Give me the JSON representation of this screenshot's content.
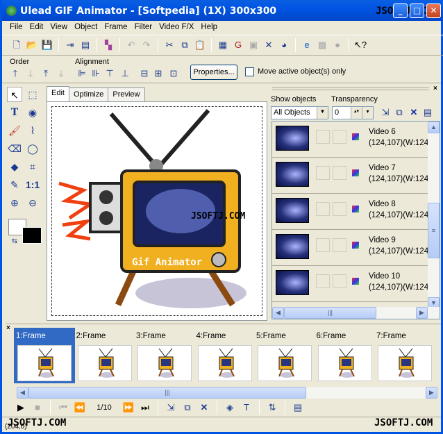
{
  "window": {
    "title": "Ulead GIF Animator - [Softpedia] (1X) 300x300",
    "watermark": "JSOFTJ.COM",
    "controls": [
      "_",
      "□",
      "✕"
    ]
  },
  "menu": [
    "File",
    "Edit",
    "View",
    "Object",
    "Frame",
    "Filter",
    "Video F/X",
    "Help"
  ],
  "toolbar": {
    "icons": [
      "new-icon",
      "open-icon",
      "save-icon",
      "import-icon",
      "export-icon",
      "optimize-icon",
      "undo-icon",
      "redo-icon",
      "cut-icon",
      "copy-icon",
      "paste-icon",
      "frame-icon",
      "gif-icon",
      "image-icon",
      "crop-icon",
      "preview-icon",
      "ie-icon",
      "disabled-icon",
      "disabled-icon2",
      "help-icon"
    ]
  },
  "order": {
    "label": "Order"
  },
  "alignment": {
    "label": "Alignment"
  },
  "properties_button": "Properties...",
  "move_active_label": "Move active object(s) only",
  "move_active_checked": false,
  "tabs": [
    "Edit",
    "Optimize",
    "Preview"
  ],
  "active_tab": "Edit",
  "canvas": {
    "tv_text": "Gif Animator",
    "watermark": "JSOFTJ.COM"
  },
  "panel": {
    "show_objects_label": "Show objects",
    "show_objects_value": "All Objects",
    "transparency_label": "Transparency",
    "transparency_value": "0",
    "objects": [
      {
        "name": "Video 6",
        "info": "(124,107)(W:124,"
      },
      {
        "name": "Video 7",
        "info": "(124,107)(W:124,"
      },
      {
        "name": "Video 8",
        "info": "(124,107)(W:124,"
      },
      {
        "name": "Video 9",
        "info": "(124,107)(W:124,"
      },
      {
        "name": "Video 10",
        "info": "(124,107)(W:124,"
      }
    ]
  },
  "frames": [
    "1:Frame",
    "2:Frame",
    "3:Frame",
    "4:Frame",
    "5:Frame",
    "6:Frame",
    "7:Frame"
  ],
  "selected_frame": "1:Frame",
  "playback": {
    "counter": "1/10"
  },
  "status": {
    "coords": "(204,0)",
    "watermark_left": "JSOFTJ.COM",
    "watermark_right": "JSOFTJ.COM"
  },
  "colors": {
    "titlebar": "#0054e3",
    "selection": "#316ac5",
    "face": "#ece9d8",
    "tv_body": "#f0b020"
  }
}
